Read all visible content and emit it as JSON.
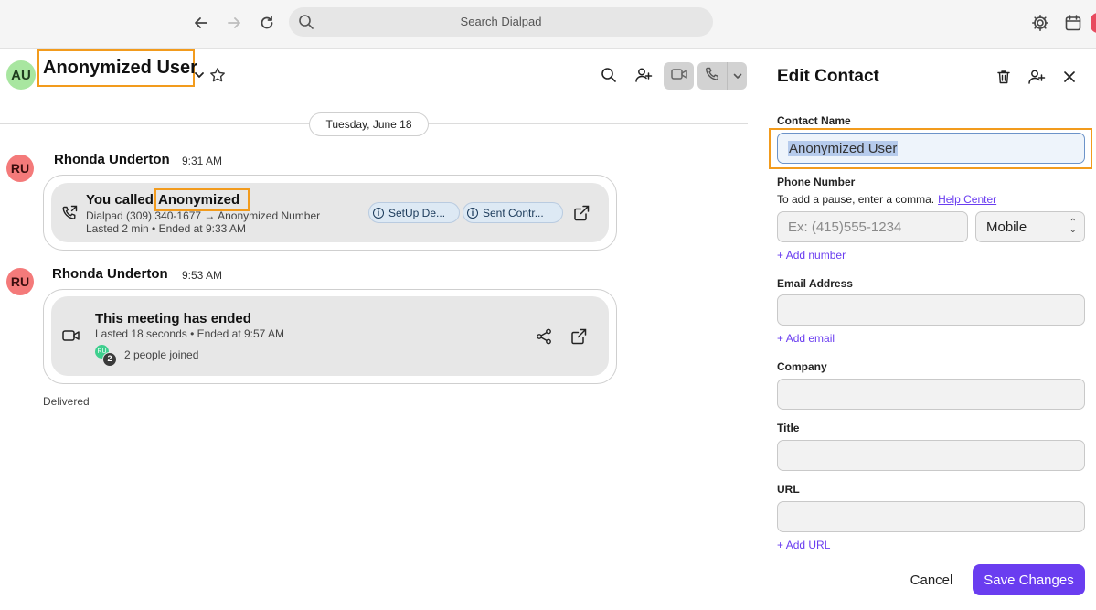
{
  "topbar": {
    "search_placeholder": "Search Dialpad",
    "icons": [
      "back-arrow-icon",
      "forward-arrow-icon",
      "reload-icon",
      "search-icon",
      "gear-icon",
      "calendar-icon"
    ]
  },
  "conversation": {
    "contact_initials": "AU",
    "contact_name": "Anonymized User",
    "date_divider": "Tuesday, June 18",
    "messages": [
      {
        "initials": "RU",
        "sender": "Rhonda Underton",
        "time": "9:31 AM",
        "title_prefix": "You called",
        "title_highlight": "Anonymized",
        "line1": "Dialpad (309) 340-1677 → Anonymized Number",
        "line2": "Lasted 2 min • Ended at 9:33 AM",
        "chips": [
          "SetUp De...",
          "Sent Contr..."
        ]
      },
      {
        "initials": "RU",
        "sender": "Rhonda Underton",
        "time": "9:53 AM",
        "title": "This meeting has ended",
        "line1": "Lasted 18 seconds • Ended at 9:57 AM",
        "participant_initials": "RU",
        "participant_count": "2",
        "joined": "2 people joined"
      }
    ],
    "delivered": "Delivered"
  },
  "edit_contact": {
    "title": "Edit Contact",
    "contact_name_label": "Contact Name",
    "contact_name_value": "Anonymized User",
    "phone_label": "Phone Number",
    "phone_hint": "To add a pause, enter a comma.",
    "help_link": "Help Center",
    "phone_placeholder": "Ex: (415)555-1234",
    "phone_type": "Mobile",
    "add_number": "Add number",
    "email_label": "Email Address",
    "add_email": "Add email",
    "company_label": "Company",
    "title_label": "Title",
    "url_label": "URL",
    "add_url": "Add URL",
    "cancel": "Cancel",
    "save": "Save Changes"
  },
  "colors": {
    "accent": "#6a3df0",
    "highlight_outline": "#f29b1d",
    "avatar_au": "#a8e6a0",
    "avatar_ru": "#f47a7a"
  }
}
